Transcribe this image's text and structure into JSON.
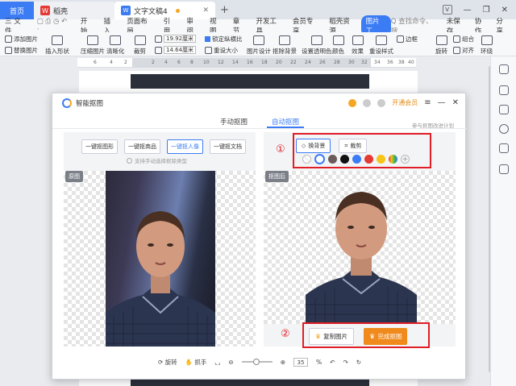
{
  "tabs": [
    {
      "label": "首页"
    },
    {
      "label": "稻壳"
    },
    {
      "label": "文字文稿4"
    }
  ],
  "menu": {
    "file": "三 文件",
    "items": [
      "开始",
      "插入",
      "页面布局",
      "引用",
      "审阅",
      "视图",
      "章节",
      "开发工具",
      "会员专享",
      "稻壳资源",
      "图片工"
    ],
    "search": "Q 查找命令、搜",
    "unsaved": "未保存",
    "collab": "协作",
    "share": "分享"
  },
  "ribbon": {
    "add_image": "添加图片",
    "replace_image": "替换图片",
    "insert_shape": "插入形状",
    "compress": "压缩图片",
    "sharpen": "清晰化",
    "crop": "裁剪",
    "width": "19.92厘米",
    "height": "14.64厘米",
    "lock_ratio": "锁定纵横比",
    "reset_size": "重设大小",
    "image_design": "图片设计",
    "cutout": "抠除背景",
    "transparent": "设置透明色",
    "color": "颜色",
    "effects": "效果",
    "reset_style": "重设样式",
    "border": "边框",
    "combine": "组合",
    "rotate": "旋转",
    "align": "对齐",
    "wrap": "环绕"
  },
  "ruler_nums": [
    "6",
    "4",
    "2",
    "2",
    "4",
    "6",
    "8",
    "10",
    "12",
    "14",
    "16",
    "18",
    "20",
    "22",
    "24",
    "26",
    "28",
    "30",
    "32",
    "34",
    "36",
    "38",
    "40"
  ],
  "dialog": {
    "title": "智能抠图",
    "vip": "开通会员",
    "tabs": {
      "manual": "手动抠图",
      "auto": "自动抠图"
    },
    "feedback": "参与抠图改进计划",
    "options": [
      "一键抠图形",
      "一键抠商品",
      "一键抠人像",
      "一键抠文档"
    ],
    "hint": "支持手动选择抠除类型",
    "original_label": "原图",
    "result_label": "抠图后",
    "bg_buttons": {
      "change_bg": "换背景",
      "crop": "裁剪"
    },
    "swatch_colors": [
      "#ffffff",
      "#6b5b5b",
      "#111111",
      "#3b7cf5",
      "#e53935",
      "#f5c518"
    ],
    "copy_btn": "复制图片",
    "done_btn": "完成抠图",
    "rotate": "旋转",
    "hand": "抓手",
    "zoom": "35",
    "zoom_unit": "%"
  },
  "annotations": {
    "one": "①",
    "two": "②"
  }
}
